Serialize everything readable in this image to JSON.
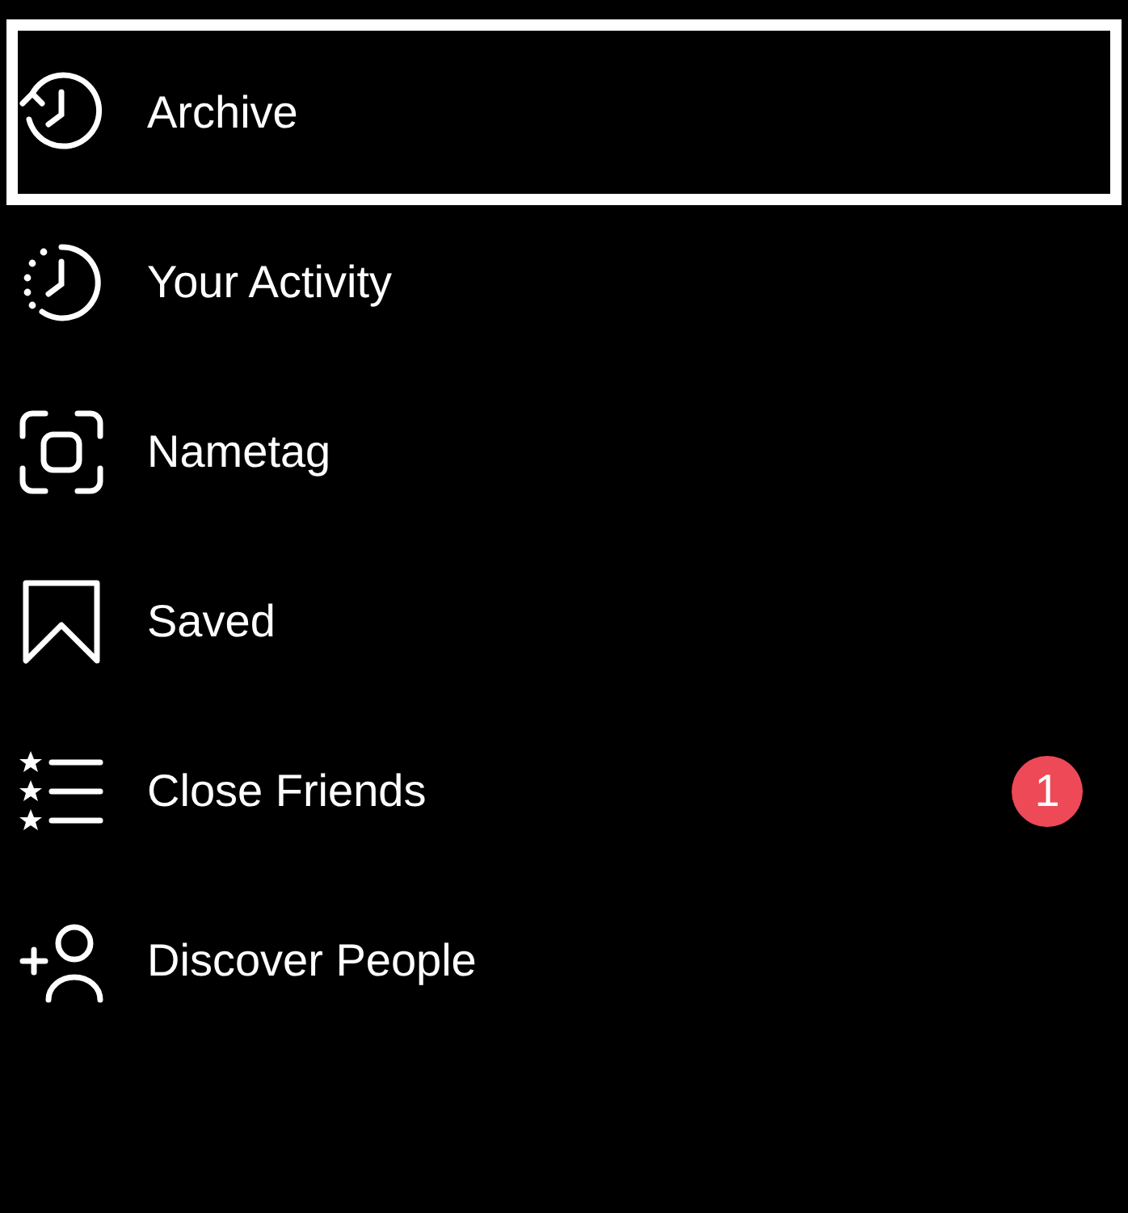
{
  "menu_items": [
    {
      "kind": "archive",
      "label": "Archive",
      "highlighted": true
    },
    {
      "kind": "activity",
      "label": "Your Activity",
      "highlighted": false
    },
    {
      "kind": "nametag",
      "label": "Nametag",
      "highlighted": false
    },
    {
      "kind": "saved",
      "label": "Saved",
      "highlighted": false
    },
    {
      "kind": "close_friends",
      "label": "Close Friends",
      "highlighted": false,
      "badge": "1"
    },
    {
      "kind": "discover",
      "label": "Discover People",
      "highlighted": false
    }
  ]
}
